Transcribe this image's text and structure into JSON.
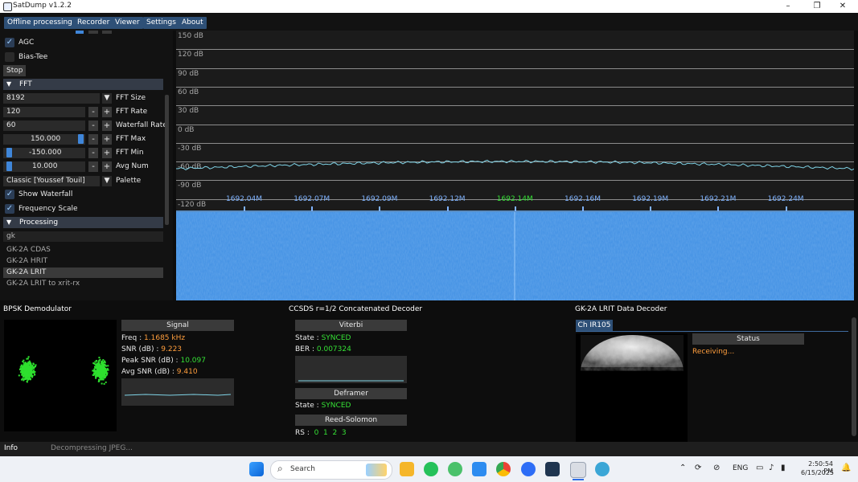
{
  "window": {
    "title": "SatDump v1.2.2",
    "minimize": "–",
    "maximize": "❐",
    "close": "✕"
  },
  "menu": [
    "Offline processing",
    "Recorder",
    "Viewer",
    "Settings",
    "About"
  ],
  "left": {
    "agc": "AGC",
    "bias_tee": "Bias-Tee",
    "stop": "Stop",
    "fft_header": "FFT",
    "fft_size": {
      "value": "8192",
      "label": "FFT Size"
    },
    "fft_rate": {
      "value": "120",
      "label": "FFT Rate"
    },
    "waterfall_rate": {
      "value": "60",
      "label": "Waterfall Rate"
    },
    "fft_max": {
      "value": "150.000",
      "label": "FFT Max"
    },
    "fft_min": {
      "value": "-150.000",
      "label": "FFT Min"
    },
    "avg_num": {
      "value": "10.000",
      "label": "Avg Num"
    },
    "palette": {
      "value": "Classic [Youssef Touil]",
      "label": "Palette"
    },
    "show_waterfall": "Show Waterfall",
    "frequency_scale": "Frequency Scale",
    "processing_header": "Processing",
    "search_value": "gk",
    "pipelines": [
      "GK-2A CDAS",
      "GK-2A HRIT",
      "GK-2A LRIT",
      "GK-2A LRIT to xrit-rx"
    ],
    "minus": "-",
    "plus": "+",
    "dropdown": "▼"
  },
  "fft": {
    "db_labels": [
      "150 dB",
      "120 dB",
      "90 dB",
      "60 dB",
      "30 dB",
      "0 dB",
      "-30 dB",
      "-60 dB",
      "-90 dB",
      "-120 dB"
    ],
    "freq_labels": [
      "1692.04M",
      "1692.07M",
      "1692.09M",
      "1692.12M",
      "1692.14M",
      "1692.16M",
      "1692.19M",
      "1692.21M",
      "1692.24M"
    ]
  },
  "bpsk": {
    "title": "BPSK Demodulator",
    "signal_header": "Signal",
    "freq_label": "Freq :",
    "freq_value": "1.1685 kHz",
    "snr_label": "SNR (dB) :",
    "snr_value": "9.223",
    "peak_label": "Peak SNR (dB) :",
    "peak_value": "10.097",
    "avg_label": "Avg SNR (dB) :",
    "avg_value": "9.410"
  },
  "ccsds": {
    "title": "CCSDS r=1/2 Concatenated Decoder",
    "viterbi_header": "Viterbi",
    "state_label": "State :",
    "state_value": "SYNCED",
    "ber_label": "BER :",
    "ber_value": "0.007324",
    "deframer_header": "Deframer",
    "deframer_state_label": "State :",
    "deframer_state_value": "SYNCED",
    "rs_header": "Reed-Solomon",
    "rs_label": "RS :",
    "rs_values": "0  1  2  3"
  },
  "lrit": {
    "title": "GK-2A LRIT Data Decoder",
    "tab": "Ch IR105",
    "status_header": "Status",
    "status_value": "Receiving..."
  },
  "statusbar": {
    "tab": "Info",
    "message": "Decompressing JPEG..."
  },
  "taskbar": {
    "search": "Search",
    "lang": "ENG",
    "time": "2:50:54 PM",
    "date": "6/15/2025"
  },
  "colors": {
    "accent": "#2e5077",
    "green": "#35e035",
    "orange": "#ff9e3d",
    "spectrum": "#7fd3e6"
  }
}
